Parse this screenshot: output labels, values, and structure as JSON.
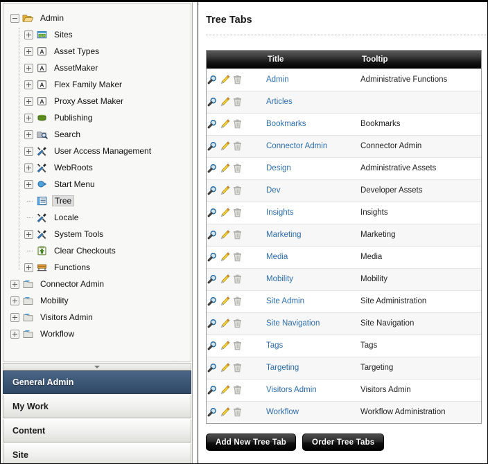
{
  "sidebar": {
    "tree": [
      {
        "label": "Admin",
        "icon": "folder-open-icon",
        "depth": 0,
        "toggle": "minus",
        "selected": false
      },
      {
        "label": "Sites",
        "icon": "sites-grid-icon",
        "depth": 1,
        "toggle": "plus",
        "selected": false
      },
      {
        "label": "Asset Types",
        "icon": "asset-a-icon",
        "depth": 1,
        "toggle": "plus",
        "selected": false
      },
      {
        "label": "AssetMaker",
        "icon": "asset-a-icon",
        "depth": 1,
        "toggle": "plus",
        "selected": false
      },
      {
        "label": "Flex Family Maker",
        "icon": "asset-a-icon",
        "depth": 1,
        "toggle": "plus",
        "selected": false
      },
      {
        "label": "Proxy Asset Maker",
        "icon": "asset-a-icon",
        "depth": 1,
        "toggle": "plus",
        "selected": false
      },
      {
        "label": "Publishing",
        "icon": "publish-drum-icon",
        "depth": 1,
        "toggle": "plus",
        "selected": false
      },
      {
        "label": "Search",
        "icon": "search-folder-icon",
        "depth": 1,
        "toggle": "plus",
        "selected": false
      },
      {
        "label": "User Access Management",
        "icon": "tools-icon",
        "depth": 1,
        "toggle": "plus",
        "selected": false
      },
      {
        "label": "WebRoots",
        "icon": "tools-icon",
        "depth": 1,
        "toggle": "plus",
        "selected": false
      },
      {
        "label": "Start Menu",
        "icon": "start-menu-icon",
        "depth": 1,
        "toggle": "plus",
        "selected": false
      },
      {
        "label": "Tree",
        "icon": "tree-list-icon",
        "depth": 1,
        "toggle": "leaf",
        "selected": true
      },
      {
        "label": "Locale",
        "icon": "tools-icon",
        "depth": 1,
        "toggle": "leaf",
        "selected": false
      },
      {
        "label": "System Tools",
        "icon": "tools-icon",
        "depth": 1,
        "toggle": "plus",
        "selected": false
      },
      {
        "label": "Clear Checkouts",
        "icon": "checkout-icon",
        "depth": 1,
        "toggle": "leaf",
        "selected": false
      },
      {
        "label": "Functions",
        "icon": "functions-icon",
        "depth": 1,
        "toggle": "plus",
        "selected": false
      },
      {
        "label": "Connector Admin",
        "icon": "folder-icon",
        "depth": 0,
        "toggle": "plus",
        "selected": false
      },
      {
        "label": "Mobility",
        "icon": "folder-icon",
        "depth": 0,
        "toggle": "plus",
        "selected": false
      },
      {
        "label": "Visitors Admin",
        "icon": "folder-icon",
        "depth": 0,
        "toggle": "plus",
        "selected": false
      },
      {
        "label": "Workflow",
        "icon": "folder-icon",
        "depth": 0,
        "toggle": "plus",
        "selected": false
      }
    ],
    "splitter": {
      "icon": "collapse-down-arrow-icon"
    },
    "nav_tabs": [
      {
        "label": "General Admin",
        "active": true
      },
      {
        "label": "My Work",
        "active": false
      },
      {
        "label": "Content",
        "active": false
      },
      {
        "label": "Site",
        "active": false
      }
    ]
  },
  "main": {
    "page_title": "Tree Tabs",
    "table": {
      "columns": [
        "",
        "Title",
        "Tooltip"
      ],
      "row_actions": [
        {
          "name": "inspect-icon",
          "title": "Inspect"
        },
        {
          "name": "edit-icon",
          "title": "Edit"
        },
        {
          "name": "delete-icon",
          "title": "Delete"
        }
      ],
      "rows": [
        {
          "title": "Admin",
          "tooltip": "Administrative Functions"
        },
        {
          "title": "Articles",
          "tooltip": ""
        },
        {
          "title": "Bookmarks",
          "tooltip": "Bookmarks"
        },
        {
          "title": "Connector Admin",
          "tooltip": "Connector Admin"
        },
        {
          "title": "Design",
          "tooltip": "Administrative Assets"
        },
        {
          "title": "Dev",
          "tooltip": "Developer Assets"
        },
        {
          "title": "Insights",
          "tooltip": "Insights"
        },
        {
          "title": "Marketing",
          "tooltip": "Marketing"
        },
        {
          "title": "Media",
          "tooltip": "Media"
        },
        {
          "title": "Mobility",
          "tooltip": "Mobility"
        },
        {
          "title": "Site Admin",
          "tooltip": "Site Administration"
        },
        {
          "title": "Site Navigation",
          "tooltip": "Site Navigation"
        },
        {
          "title": "Tags",
          "tooltip": "Tags"
        },
        {
          "title": "Targeting",
          "tooltip": "Targeting"
        },
        {
          "title": "Visitors Admin",
          "tooltip": "Visitors Admin"
        },
        {
          "title": "Workflow",
          "tooltip": "Workflow Administration"
        }
      ]
    },
    "buttons": [
      {
        "label": "Add New Tree Tab",
        "name": "add-new-tree-tab-button"
      },
      {
        "label": "Order Tree Tabs",
        "name": "order-tree-tabs-button"
      }
    ]
  },
  "colors": {
    "link": "#2e6da8",
    "active_tab": "#3c5676",
    "header_bar": "#000000",
    "folder_yellow": "#f0c419"
  }
}
